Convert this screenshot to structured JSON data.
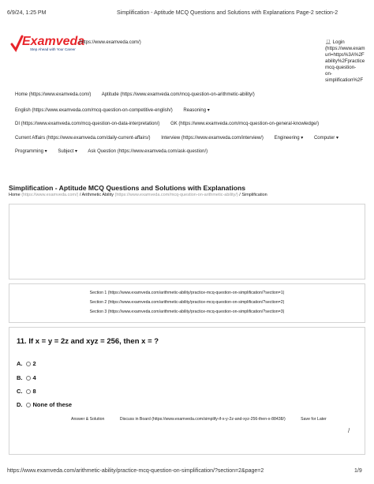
{
  "print_header": {
    "datetime": "6/9/24, 1:25 PM",
    "page_title": "Simplification - Aptitude MCQ Questions and Solutions with Explanations Page-2 section-2"
  },
  "brand": {
    "name": "Examveda",
    "tagline": "Step Ahead with Your Career",
    "url_text": "(https://www.examveda.com/)",
    "color": "#e8252b"
  },
  "login": {
    "icon": "user-icon",
    "label": "Login",
    "lines": [
      "(https://www.exam",
      "url=https%3A%2F",
      "ability%2Fpractice",
      "mcq-question-",
      "on-",
      "simplification%2F"
    ]
  },
  "nav": {
    "row1": [
      "Home (https://www.examveda.com/)",
      "Aptitude (https://www.examveda.com/mcq-question-on-arithmetic-ability/)"
    ],
    "row2": [
      "English (https://www.examveda.com/mcq-question-on-competitive-english/)",
      "Reasoning ▾"
    ],
    "row3": [
      "DI (https://www.examveda.com/mcq-question-on-data-interpretation/)",
      "GK (https://www.examveda.com/mcq-question-on-general-knowledge/)"
    ],
    "row4": [
      "Current Affairs (https://www.examveda.com/daily-current-affairs/)",
      "Interview (https://www.examveda.com/interview/)",
      "Engineering ▾",
      "Computer ▾"
    ],
    "row5": [
      "Programming ▾",
      "Subject ▾",
      "Ask Question (https://www.examveda.com/ask-question/)"
    ]
  },
  "page": {
    "title": "Simplification - Aptitude MCQ Questions and Solutions with Explanations",
    "breadcrumb_home": "Home",
    "breadcrumb_home_url": "(https://www.examveda.com/)",
    "breadcrumb_sep": "/",
    "breadcrumb_arith": "Arithmetic Ability",
    "breadcrumb_arith_url": "(https://www.examveda.com/mcq-question-on-arithmetic-ability/)",
    "breadcrumb_current": "Simplification"
  },
  "sections": [
    "Section 1 (https://www.examveda.com/arithmetic-ability/practice-mcq-question-on-simplification/?section=1)",
    "Section 2 (https://www.examveda.com/arithmetic-ability/practice-mcq-question-on-simplification/?section=2)",
    "Section 3 (https://www.examveda.com/arithmetic-ability/practice-mcq-question-on-simplification/?section=3)"
  ],
  "question": {
    "text": "11. If x = y = 2z and xyz = 256, then x = ?",
    "options": [
      {
        "letter": "A.",
        "value": "2"
      },
      {
        "letter": "B.",
        "value": "4"
      },
      {
        "letter": "C.",
        "value": "8"
      },
      {
        "letter": "D.",
        "value": "None of these"
      }
    ],
    "actions": {
      "answer": "Answer & Solution",
      "discuss": "Discuss in Board (https://www.examveda.com/simplify-if-x-y-2z-and-xyz-256-then-x-88438/)",
      "save": "Save for Later"
    },
    "slash_mark": "/"
  },
  "footer": {
    "url": "https://www.examveda.com/arithmetic-ability/practice-mcq-question-on-simplification/?section=2&page=2",
    "page_num": "1/9"
  }
}
